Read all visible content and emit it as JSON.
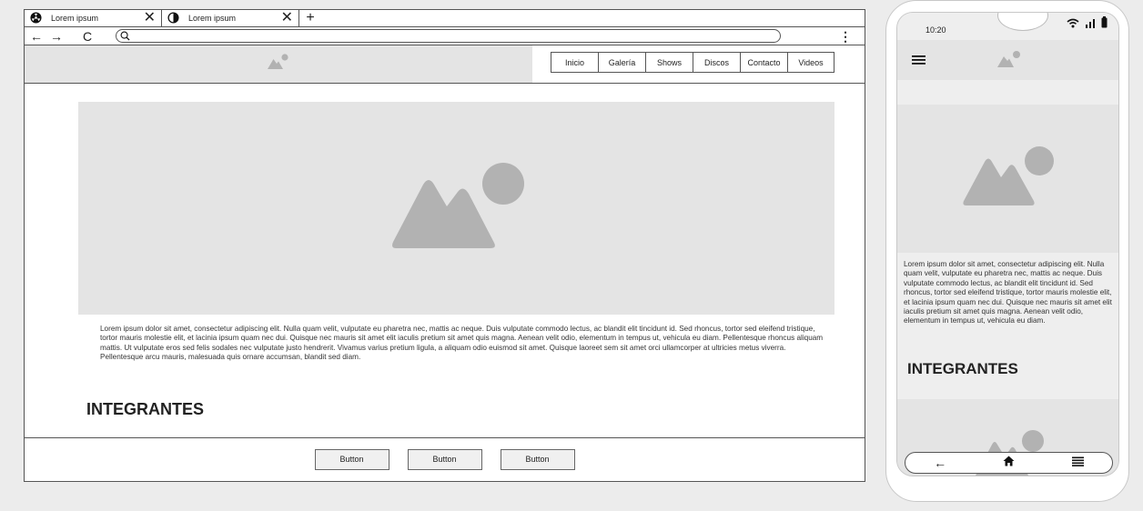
{
  "browser": {
    "tabs": [
      {
        "label": "Lorem ipsum",
        "icon": "radiation-icon"
      },
      {
        "label": "Lorem ipsum",
        "icon": "contrast-icon"
      }
    ],
    "close_glyph": "✕",
    "add_tab_glyph": "+",
    "back_glyph": "←",
    "forward_glyph": "→",
    "reload_glyph": "C",
    "menu_glyph": "⋮"
  },
  "site": {
    "nav": [
      {
        "label": "Inicio"
      },
      {
        "label": "Galería"
      },
      {
        "label": "Shows"
      },
      {
        "label": "Discos"
      },
      {
        "label": "Contacto"
      },
      {
        "label": "Videos"
      }
    ],
    "paragraph": "Lorem ipsum dolor sit amet, consectetur adipiscing elit. Nulla quam velit, vulputate eu pharetra nec, mattis ac neque. Duis vulputate commodo lectus, ac blandit elit tincidunt id. Sed rhoncus, tortor sed eleifend tristique, tortor mauris molestie elit, et lacinia ipsum quam nec dui. Quisque nec mauris sit amet elit iaculis pretium sit amet quis magna. Aenean velit odio, elementum in tempus ut, vehicula eu diam. Pellentesque rhoncus aliquam mattis. Ut vulputate eros sed felis sodales nec vulputate justo hendrerit. Vivamus varius pretium ligula, a aliquam odio euismod sit amet. Quisque laoreet sem sit amet orci ullamcorper at ultricies metus viverra. Pellentesque arcu mauris, malesuada quis ornare accumsan, blandit sed diam.",
    "section_title": "INTEGRANTES",
    "footer_buttons": [
      {
        "label": "Button"
      },
      {
        "label": "Button"
      },
      {
        "label": "Button"
      }
    ]
  },
  "phone": {
    "time": "10:20",
    "paragraph": "Lorem ipsum dolor sit amet, consectetur adipiscing elit. Nulla quam velit, vulputate eu pharetra nec, mattis ac neque. Duis vulputate commodo lectus, ac blandit elit tincidunt id. Sed rhoncus, tortor sed eleifend tristique, tortor mauris molestie elit, et lacinia ipsum quam nec dui. Quisque nec mauris sit amet elit iaculis pretium sit amet quis magna. Aenean velit odio, elementum in tempus ut, vehicula eu diam.",
    "section_title": "INTEGRANTES",
    "nav_back_glyph": "←",
    "nav_home_glyph": "⌂",
    "nav_menu_glyph": "≣"
  },
  "colors": {
    "placeholder_bg": "#e4e4e4",
    "placeholder_icon": "#b2b2b2",
    "border": "#555555"
  }
}
